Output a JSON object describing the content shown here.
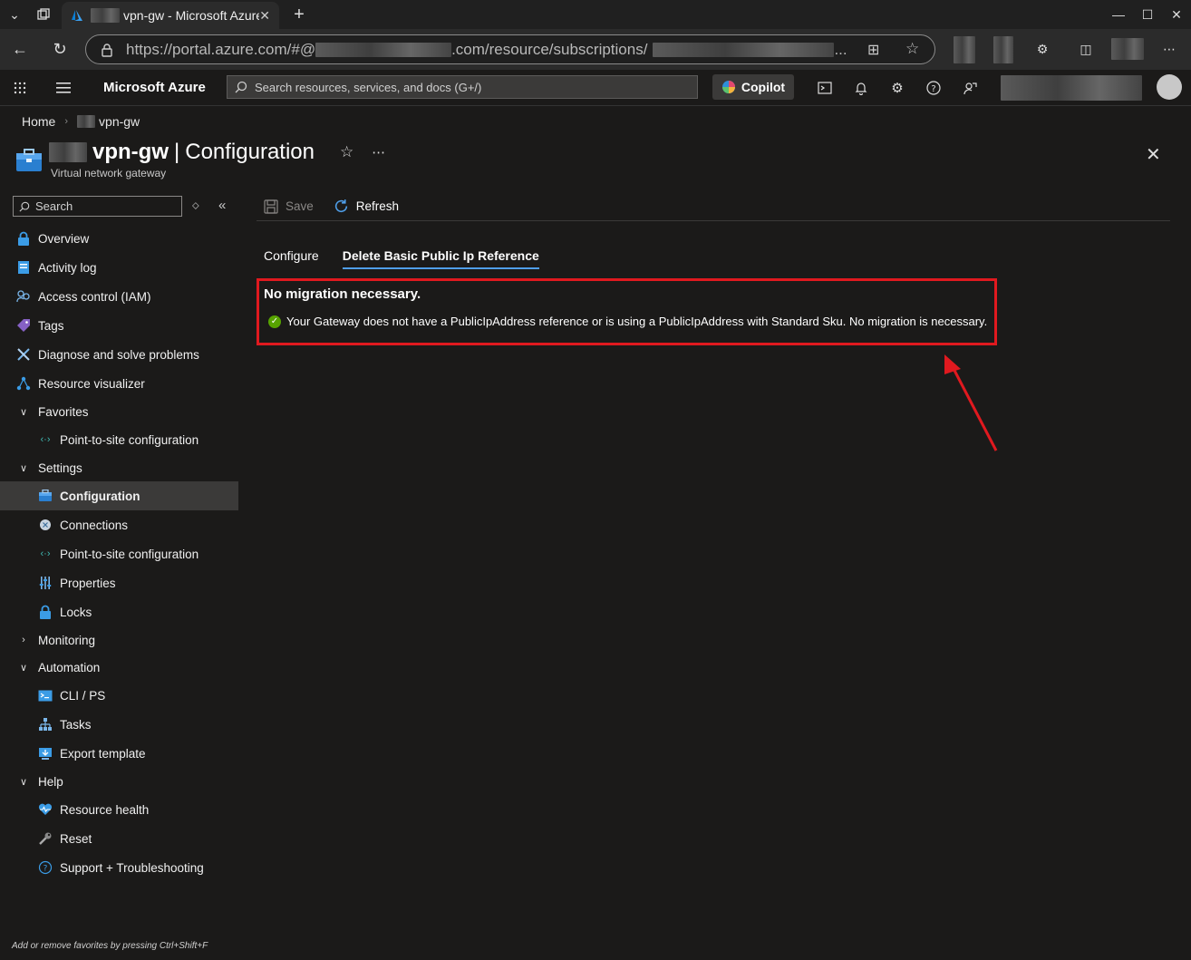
{
  "browser": {
    "tab_title": "vpn-gw - Microsoft Azure",
    "url_prefix": "https://portal.azure.com/#@",
    "url_mid": ".com/resource/subscriptions/",
    "url_ellipsis": "..."
  },
  "azure": {
    "brand": "Microsoft Azure",
    "search_placeholder": "Search resources, services, and docs (G+/)",
    "copilot_label": "Copilot"
  },
  "breadcrumb": {
    "home": "Home",
    "current": "vpn-gw"
  },
  "header": {
    "resource_name": "vpn-gw",
    "separator": "|",
    "blade": "Configuration",
    "subtitle": "Virtual network gateway"
  },
  "sidebar": {
    "search_placeholder": "Search",
    "items": [
      {
        "label": "Overview"
      },
      {
        "label": "Activity log"
      },
      {
        "label": "Access control (IAM)"
      },
      {
        "label": "Tags"
      },
      {
        "label": "Diagnose and solve problems"
      },
      {
        "label": "Resource visualizer"
      },
      {
        "label": "Favorites"
      },
      {
        "label": "Point-to-site configuration"
      },
      {
        "label": "Settings"
      },
      {
        "label": "Configuration"
      },
      {
        "label": "Connections"
      },
      {
        "label": "Point-to-site configuration"
      },
      {
        "label": "Properties"
      },
      {
        "label": "Locks"
      },
      {
        "label": "Monitoring"
      },
      {
        "label": "Automation"
      },
      {
        "label": "CLI / PS"
      },
      {
        "label": "Tasks"
      },
      {
        "label": "Export template"
      },
      {
        "label": "Help"
      },
      {
        "label": "Resource health"
      },
      {
        "label": "Reset"
      },
      {
        "label": "Support + Troubleshooting"
      }
    ],
    "footer_hint": "Add or remove favorites by pressing Ctrl+Shift+F"
  },
  "toolbar": {
    "save_label": "Save",
    "refresh_label": "Refresh"
  },
  "tabs": [
    {
      "label": "Configure"
    },
    {
      "label": "Delete Basic Public Ip Reference"
    }
  ],
  "message": {
    "title": "No migration necessary.",
    "body": "Your Gateway does not have a PublicIpAddress reference or is using a PublicIpAddress with Standard Sku. No migration is necessary."
  },
  "colors": {
    "highlight": "#e0191f",
    "accent": "#4f9ee8",
    "success": "#57a300",
    "background": "#1b1a19"
  }
}
